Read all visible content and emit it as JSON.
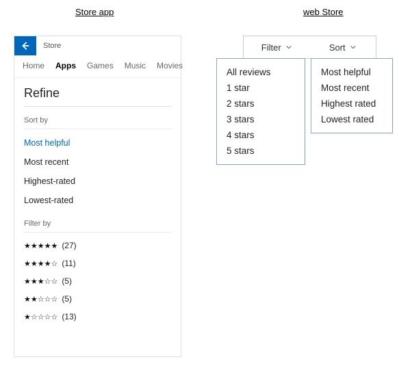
{
  "headings": {
    "left": "Store app",
    "right": "web Store"
  },
  "store_app": {
    "title": "Store",
    "tabs": [
      "Home",
      "Apps",
      "Games",
      "Music",
      "Movies"
    ],
    "active_tab": "Apps",
    "refine_title": "Refine",
    "sort_label": "Sort by",
    "sort_options": [
      "Most helpful",
      "Most recent",
      "Highest-rated",
      "Lowest-rated"
    ],
    "sort_selected": "Most helpful",
    "filter_label": "Filter by",
    "filter_options": [
      {
        "stars": 5,
        "count": 27
      },
      {
        "stars": 4,
        "count": 11
      },
      {
        "stars": 3,
        "count": 5
      },
      {
        "stars": 2,
        "count": 5
      },
      {
        "stars": 1,
        "count": 13
      }
    ]
  },
  "web_store": {
    "filter_btn": "Filter",
    "sort_btn": "Sort",
    "filter_menu": [
      "All reviews",
      "1 star",
      "2 stars",
      "3 stars",
      "4 stars",
      "5 stars"
    ],
    "sort_menu": [
      "Most helpful",
      "Most recent",
      "Highest rated",
      "Lowest rated"
    ]
  }
}
